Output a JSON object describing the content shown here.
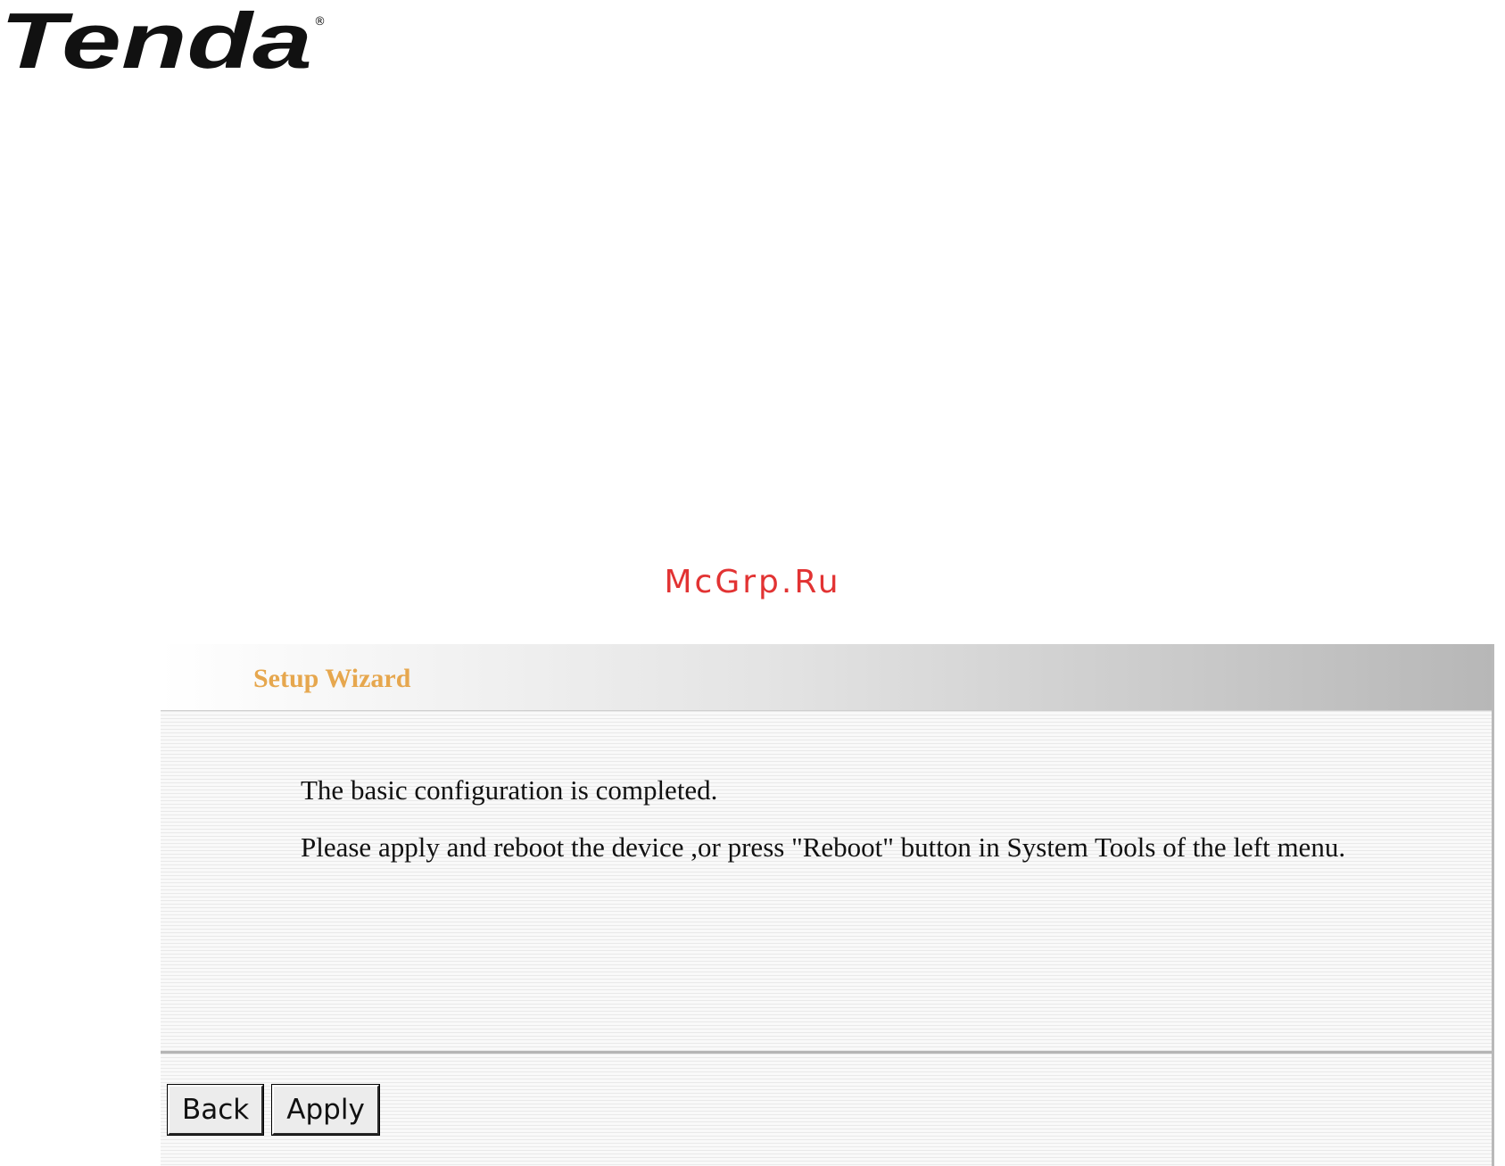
{
  "brand": {
    "logo_text": "Tenda"
  },
  "watermark": {
    "text": "McGrp.Ru"
  },
  "wizard": {
    "title": "Setup Wizard",
    "message_line1": "The basic configuration is completed.",
    "message_line2": "Please apply and reboot the device ,or press \"Reboot\" button in System Tools of the left menu.",
    "buttons": {
      "back_label": "Back",
      "apply_label": "Apply"
    }
  },
  "colors": {
    "title_accent": "#e6a74e",
    "watermark": "#e23333"
  }
}
